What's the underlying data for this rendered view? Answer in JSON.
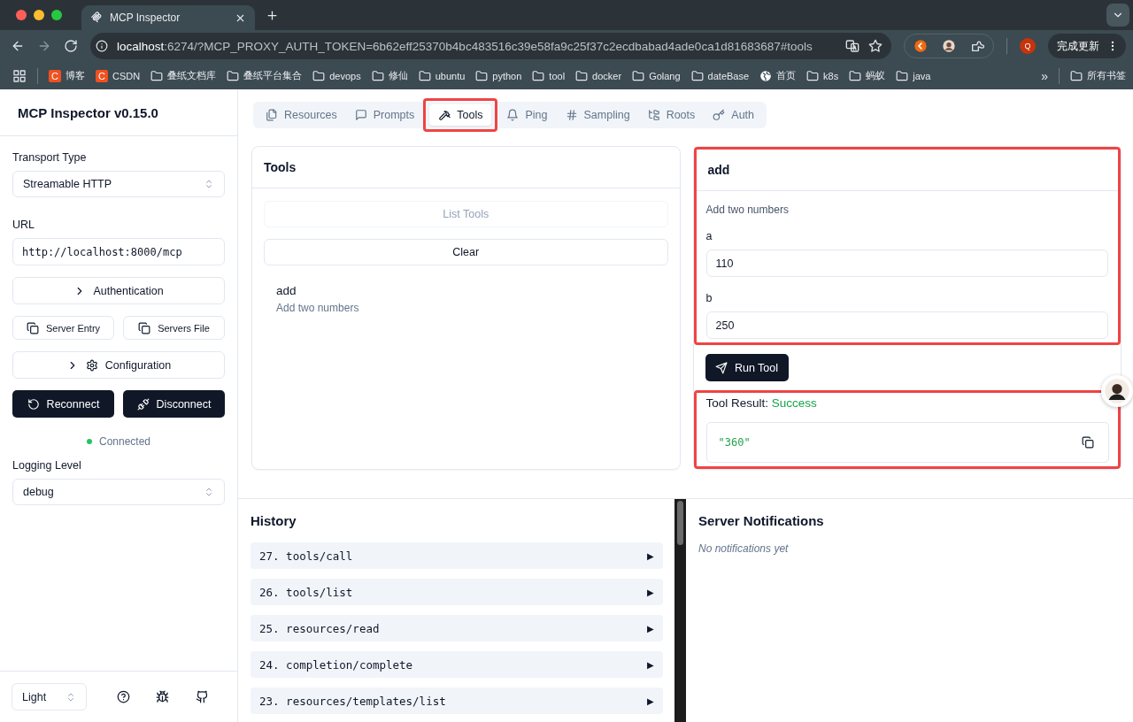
{
  "browser": {
    "tab_title": "MCP Inspector",
    "url_host": "localhost",
    "url_rest": ":6274/?MCP_PROXY_AUTH_TOKEN=6b62eff25370b4bc483516c39e58fa9c25f37c2ecdbabad4ade0ca1d81683687#tools",
    "profile_initial": "Q",
    "update_button": "完成更新",
    "bookmarks": [
      {
        "kind": "site",
        "badge": "C",
        "label": "博客"
      },
      {
        "kind": "site",
        "badge": "C",
        "label": "CSDN"
      },
      {
        "kind": "folder",
        "label": "叠纸文档库"
      },
      {
        "kind": "folder",
        "label": "叠纸平台集合"
      },
      {
        "kind": "folder",
        "label": "devops"
      },
      {
        "kind": "folder",
        "label": "修仙"
      },
      {
        "kind": "folder",
        "label": "ubuntu"
      },
      {
        "kind": "folder",
        "label": "python"
      },
      {
        "kind": "folder",
        "label": "tool"
      },
      {
        "kind": "folder",
        "label": "docker"
      },
      {
        "kind": "folder",
        "label": "Golang"
      },
      {
        "kind": "folder",
        "label": "dateBase"
      },
      {
        "kind": "globe",
        "label": "首页"
      },
      {
        "kind": "folder",
        "label": "k8s"
      },
      {
        "kind": "folder",
        "label": "蚂蚁"
      },
      {
        "kind": "folder",
        "label": "java"
      }
    ],
    "overflow": "»",
    "all_bookmarks": "所有书签"
  },
  "sidebar": {
    "title": "MCP Inspector v0.15.0",
    "transport_label": "Transport Type",
    "transport_value": "Streamable HTTP",
    "url_label": "URL",
    "url_value": "http://localhost:8000/mcp",
    "authentication": "Authentication",
    "server_entry": "Server Entry",
    "servers_file": "Servers File",
    "configuration": "Configuration",
    "reconnect": "Reconnect",
    "disconnect": "Disconnect",
    "status": {
      "text": "Connected",
      "connected": true
    },
    "logging_label": "Logging Level",
    "logging_value": "debug",
    "theme": "Light"
  },
  "tabs": [
    {
      "kind": "files",
      "label": "Resources",
      "selected": false,
      "highlighted": false
    },
    {
      "kind": "message",
      "label": "Prompts",
      "selected": false,
      "highlighted": false
    },
    {
      "kind": "hammer",
      "label": "Tools",
      "selected": true,
      "highlighted": true
    },
    {
      "kind": "bell",
      "label": "Ping",
      "selected": false,
      "highlighted": false
    },
    {
      "kind": "hash",
      "label": "Sampling",
      "selected": false,
      "highlighted": false
    },
    {
      "kind": "tree",
      "label": "Roots",
      "selected": false,
      "highlighted": false
    },
    {
      "kind": "key",
      "label": "Auth",
      "selected": false,
      "highlighted": false
    }
  ],
  "tools_panel": {
    "title": "Tools",
    "list_button": {
      "label": "List Tools",
      "disabled": true
    },
    "clear_button": "Clear",
    "items": [
      {
        "name": "add",
        "description": "Add two numbers"
      }
    ]
  },
  "tool_form": {
    "title": "add",
    "description": "Add two numbers",
    "highlighted": true,
    "fields": [
      {
        "label": "a",
        "value": "110"
      },
      {
        "label": "b",
        "value": "250"
      }
    ],
    "run_button": "Run Tool"
  },
  "tool_result": {
    "label": "Tool Result:",
    "status": "Success",
    "value": "\"360\"",
    "highlighted": true
  },
  "history": {
    "title": "History",
    "entries": [
      "27. tools/call",
      "26. tools/list",
      "25. resources/read",
      "24. completion/complete",
      "23. resources/templates/list"
    ],
    "expand_marker": "▶"
  },
  "notifications": {
    "title": "Server Notifications",
    "empty_text": "No notifications yet"
  }
}
